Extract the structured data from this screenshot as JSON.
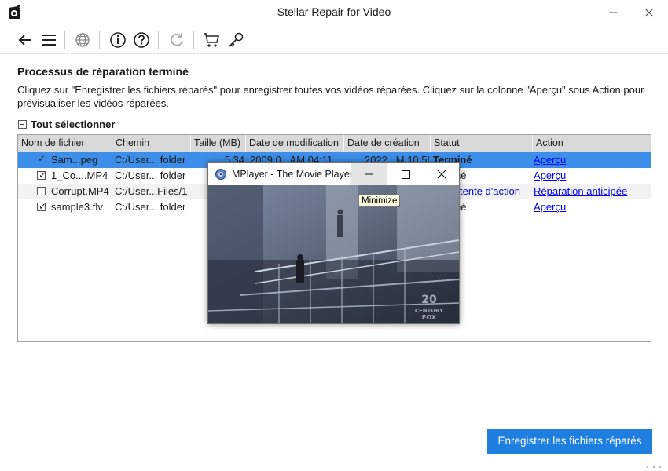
{
  "window": {
    "title": "Stellar Repair for Video"
  },
  "toolbar": {
    "icons": [
      "back-arrow-icon",
      "menu-icon",
      "globe-icon",
      "info-icon",
      "help-icon",
      "refresh-icon",
      "cart-icon",
      "key-icon"
    ]
  },
  "main": {
    "heading": "Processus de réparation terminé",
    "instructions": "Cliquez sur \"Enregistrer les fichiers réparés\" pour enregistrer toutes vos vidéos réparées. Cliquez sur la colonne \"Aperçu\" sous Action pour prévisualiser les vidéos réparées.",
    "select_all": "Tout sélectionner"
  },
  "table": {
    "columns": [
      "Nom de fichier",
      "Chemin",
      "Taille (MB)",
      "Date de modification",
      "Date de création",
      "Statut",
      "Action"
    ],
    "rows": [
      {
        "checked": true,
        "name": "Sam...peg",
        "path": "C:/User... folder",
        "size": "5.34",
        "modified": "2009.0...AM 04:11",
        "created": "2022...M 10:58",
        "status": "Terminé",
        "action": "Aperçu"
      },
      {
        "checked": true,
        "name": "1_Co....MP4",
        "path": "C:/User... folder",
        "size": "",
        "modified": "",
        "created": "",
        "status": "Terminé",
        "action": "Aperçu"
      },
      {
        "checked": false,
        "name": "Corrupt.MP4",
        "path": "C:/User...Files/1",
        "size": "",
        "modified": "",
        "created": "",
        "status": "En attente d'action",
        "action": "Réparation anticipée"
      },
      {
        "checked": true,
        "name": "sample3.flv",
        "path": "C:/User... folder",
        "size": "",
        "modified": "",
        "created": "",
        "status": "Terminé",
        "action": "Aperçu"
      }
    ],
    "visible": {
      "r0": {
        "status": "Terminé"
      },
      "r1": {
        "status": "né"
      },
      "r2": {
        "status": "tente d'action"
      },
      "r3": {
        "status": "né"
      }
    }
  },
  "mplayer": {
    "title": "MPlayer - The Movie Player",
    "tooltip": "Minimize",
    "watermark": "20TH CENTURY FOX"
  },
  "footer": {
    "save_button": "Enregistrer les fichiers réparés"
  },
  "colors": {
    "accent": "#1f7fe0",
    "row_selected": "#3d8ee8",
    "header_bg": "#d9d9d9",
    "link": "#0000ee"
  }
}
